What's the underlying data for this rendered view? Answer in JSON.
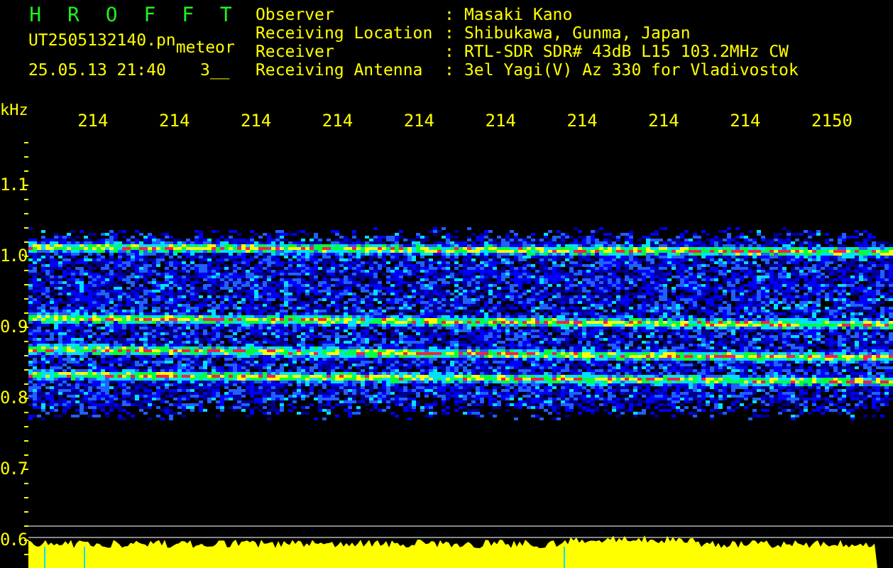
{
  "title": "H R O F F T",
  "file": {
    "name": "UT2505132140.pn",
    "tag": "meteor"
  },
  "timestamp": "25.05.13 21:40",
  "count": "3__",
  "info": [
    {
      "label": "Observer",
      "separator": ":",
      "value": "Masaki Kano"
    },
    {
      "label": "Receiving Location",
      "separator": ":",
      "value": "Shibukawa, Gunma, Japan"
    },
    {
      "label": "Receiver",
      "separator": ":",
      "value": "RTL-SDR SDR# 43dB L15 103.2MHz CW"
    },
    {
      "label": "Receiving Antenna",
      "separator": ":",
      "value": "3el Yagi(V) Az 330 for Vladivostok"
    }
  ],
  "y_axis": {
    "unit": "kHz",
    "labels": [
      "1.1",
      "1.0",
      "0.9",
      "0.8",
      "0.7",
      "0.6"
    ]
  },
  "x_axis": {
    "labels": [
      "214",
      "214",
      "214",
      "214",
      "214",
      "214",
      "214",
      "214",
      "214",
      "2150"
    ]
  }
}
